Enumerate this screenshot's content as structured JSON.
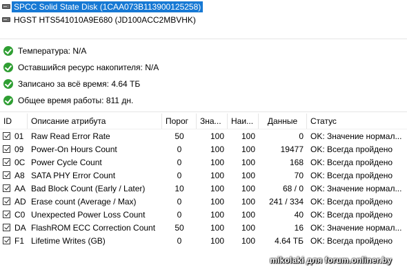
{
  "disks": [
    {
      "label": "SPCC Solid State Disk (1CAA073B113900125258)",
      "selected": true
    },
    {
      "label": "HGST HTS541010A9E680 (JD100ACC2MBVHK)",
      "selected": false
    }
  ],
  "summary": [
    {
      "text": "Температура: N/A"
    },
    {
      "text": "Оставшийся ресурс накопителя: N/A"
    },
    {
      "text": "Записано за всё время: 4.64 ТБ"
    },
    {
      "text": "Общее время работы: 811 дн."
    }
  ],
  "table": {
    "headers": {
      "id": "ID",
      "desc": "Описание атрибута",
      "thr": "Порог",
      "val": "Зна...",
      "wor": "Наи...",
      "raw": "Данные",
      "stat": "Статус"
    },
    "rows": [
      {
        "id": "01",
        "desc": "Raw Read Error Rate",
        "thr": "50",
        "val": "100",
        "wor": "100",
        "raw": "0",
        "stat": "OK: Значение нормал..."
      },
      {
        "id": "09",
        "desc": "Power-On Hours Count",
        "thr": "0",
        "val": "100",
        "wor": "100",
        "raw": "19477",
        "stat": "OK: Всегда пройдено"
      },
      {
        "id": "0C",
        "desc": "Power Cycle Count",
        "thr": "0",
        "val": "100",
        "wor": "100",
        "raw": "168",
        "stat": "OK: Всегда пройдено"
      },
      {
        "id": "A8",
        "desc": "SATA PHY Error Count",
        "thr": "0",
        "val": "100",
        "wor": "100",
        "raw": "70",
        "stat": "OK: Всегда пройдено"
      },
      {
        "id": "AA",
        "desc": "Bad Block Count (Early / Later)",
        "thr": "10",
        "val": "100",
        "wor": "100",
        "raw": "68 / 0",
        "stat": "OK: Значение нормал..."
      },
      {
        "id": "AD",
        "desc": "Erase count (Average / Max)",
        "thr": "0",
        "val": "100",
        "wor": "100",
        "raw": "241 / 334",
        "stat": "OK: Всегда пройдено"
      },
      {
        "id": "C0",
        "desc": "Unexpected Power Loss Count",
        "thr": "0",
        "val": "100",
        "wor": "100",
        "raw": "40",
        "stat": "OK: Всегда пройдено"
      },
      {
        "id": "DA",
        "desc": "FlashROM ECC Correction Count",
        "thr": "50",
        "val": "100",
        "wor": "100",
        "raw": "16",
        "stat": "OK: Значение нормал..."
      },
      {
        "id": "F1",
        "desc": "Lifetime Writes (GB)",
        "thr": "0",
        "val": "100",
        "wor": "100",
        "raw": "4.64 ТБ",
        "stat": "OK: Всегда пройдено"
      }
    ]
  },
  "watermark": "mikolaki для forum.onliner.by",
  "colors": {
    "selection": "#1779d4",
    "ok": "#2f9e33"
  }
}
